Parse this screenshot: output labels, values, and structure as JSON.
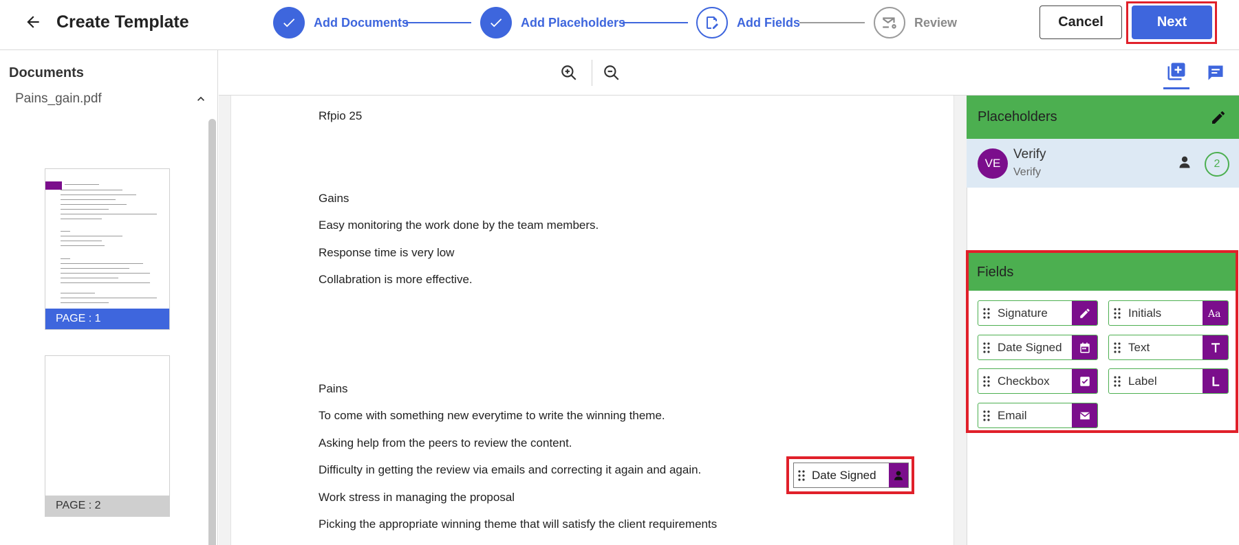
{
  "header": {
    "title": "Create Template",
    "back_icon": "arrow-left-icon",
    "steps": [
      {
        "label": "Add Documents",
        "state": "done"
      },
      {
        "label": "Add Placeholders",
        "state": "done"
      },
      {
        "label": "Add Fields",
        "state": "active"
      },
      {
        "label": "Review",
        "state": "pending"
      }
    ],
    "cancel_label": "Cancel",
    "next_label": "Next"
  },
  "sidebar": {
    "title": "Documents",
    "document_name": "Pains_gain.pdf",
    "pages": [
      {
        "label": "PAGE : 1",
        "selected": true
      },
      {
        "label": "PAGE : 2",
        "selected": false
      }
    ]
  },
  "document": {
    "lines": [
      "Rfpio 25",
      "Gains",
      "Easy monitoring the work done by the team members.",
      "Response time is very low",
      "Collabration is more effective.",
      "Pains",
      "To come with something new everytime to write the winning theme.",
      "Asking help from the peers to review the content.",
      "Difficulty in getting the review via emails and correcting it again and again.",
      "Work stress in managing the proposal",
      "Picking the appropriate winning theme that will satisfy the client requirements"
    ],
    "placed_field": {
      "label": "Date Signed",
      "icon": "person-icon"
    }
  },
  "placeholders": {
    "title": "Placeholders",
    "items": [
      {
        "initials": "VE",
        "name": "Verify",
        "subtitle": "Verify",
        "count": "2"
      }
    ]
  },
  "fields": {
    "title": "Fields",
    "items": [
      {
        "label": "Signature",
        "icon": "pen-icon"
      },
      {
        "label": "Initials",
        "icon": "initials-icon"
      },
      {
        "label": "Date Signed",
        "icon": "calendar-icon"
      },
      {
        "label": "Text",
        "icon": "text-icon"
      },
      {
        "label": "Checkbox",
        "icon": "checkbox-icon"
      },
      {
        "label": "Label",
        "icon": "label-icon"
      },
      {
        "label": "Email",
        "icon": "envelope-icon"
      }
    ]
  },
  "colors": {
    "primary": "#3e66dd",
    "green": "#4caf50",
    "purple": "#7b0e8c",
    "highlight": "#e0202a"
  }
}
